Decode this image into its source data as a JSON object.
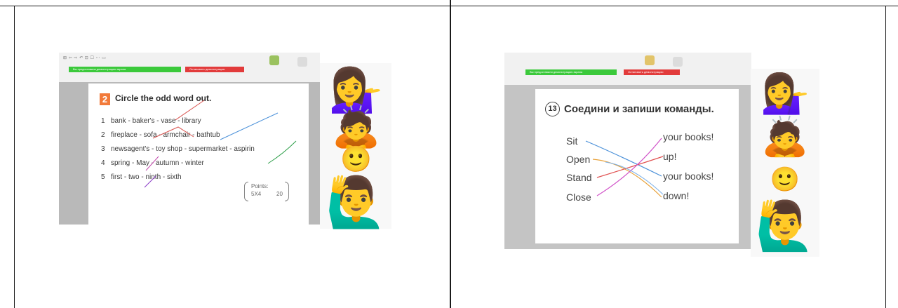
{
  "left_slide": {
    "ribbon_text": "⊞ ⇦ ⇨ ↶ ⊡ ☐ ⋯ ▭",
    "green_bar": "Вы предоставили демонстрацию экрана",
    "red_bar": "Остановить демонстрацию",
    "exercise_number": "2",
    "exercise_title": "Circle the odd word out.",
    "rows": [
      {
        "n": "1",
        "text": "bank - baker's - vase - library"
      },
      {
        "n": "2",
        "text": "fireplace - sofa - armchair - bathtub"
      },
      {
        "n": "3",
        "text": "newsagent's - toy shop - supermarket - aspirin"
      },
      {
        "n": "4",
        "text": "spring - May - autumn - winter"
      },
      {
        "n": "5",
        "text": "first - two - ninth - sixth"
      }
    ],
    "points_label": "Points:",
    "points_mul": "5X4",
    "points_total": "20",
    "emojis": [
      "💁‍♀️",
      "🙇",
      "🙂",
      "🙋‍♂️"
    ]
  },
  "right_slide": {
    "green_bar": "Вы предоставили демонстрацию экрана",
    "red_bar": "Остановить демонстрацию",
    "exercise_number": "13",
    "exercise_title": "Соедини и запиши команды.",
    "left_words": [
      "Sit",
      "Open",
      "Stand",
      "Close"
    ],
    "right_words": [
      "your books!",
      "up!",
      "your books!",
      "down!"
    ],
    "emojis": [
      "💁‍♀️",
      "🙇",
      "🙂",
      "🙋‍♂️"
    ]
  }
}
